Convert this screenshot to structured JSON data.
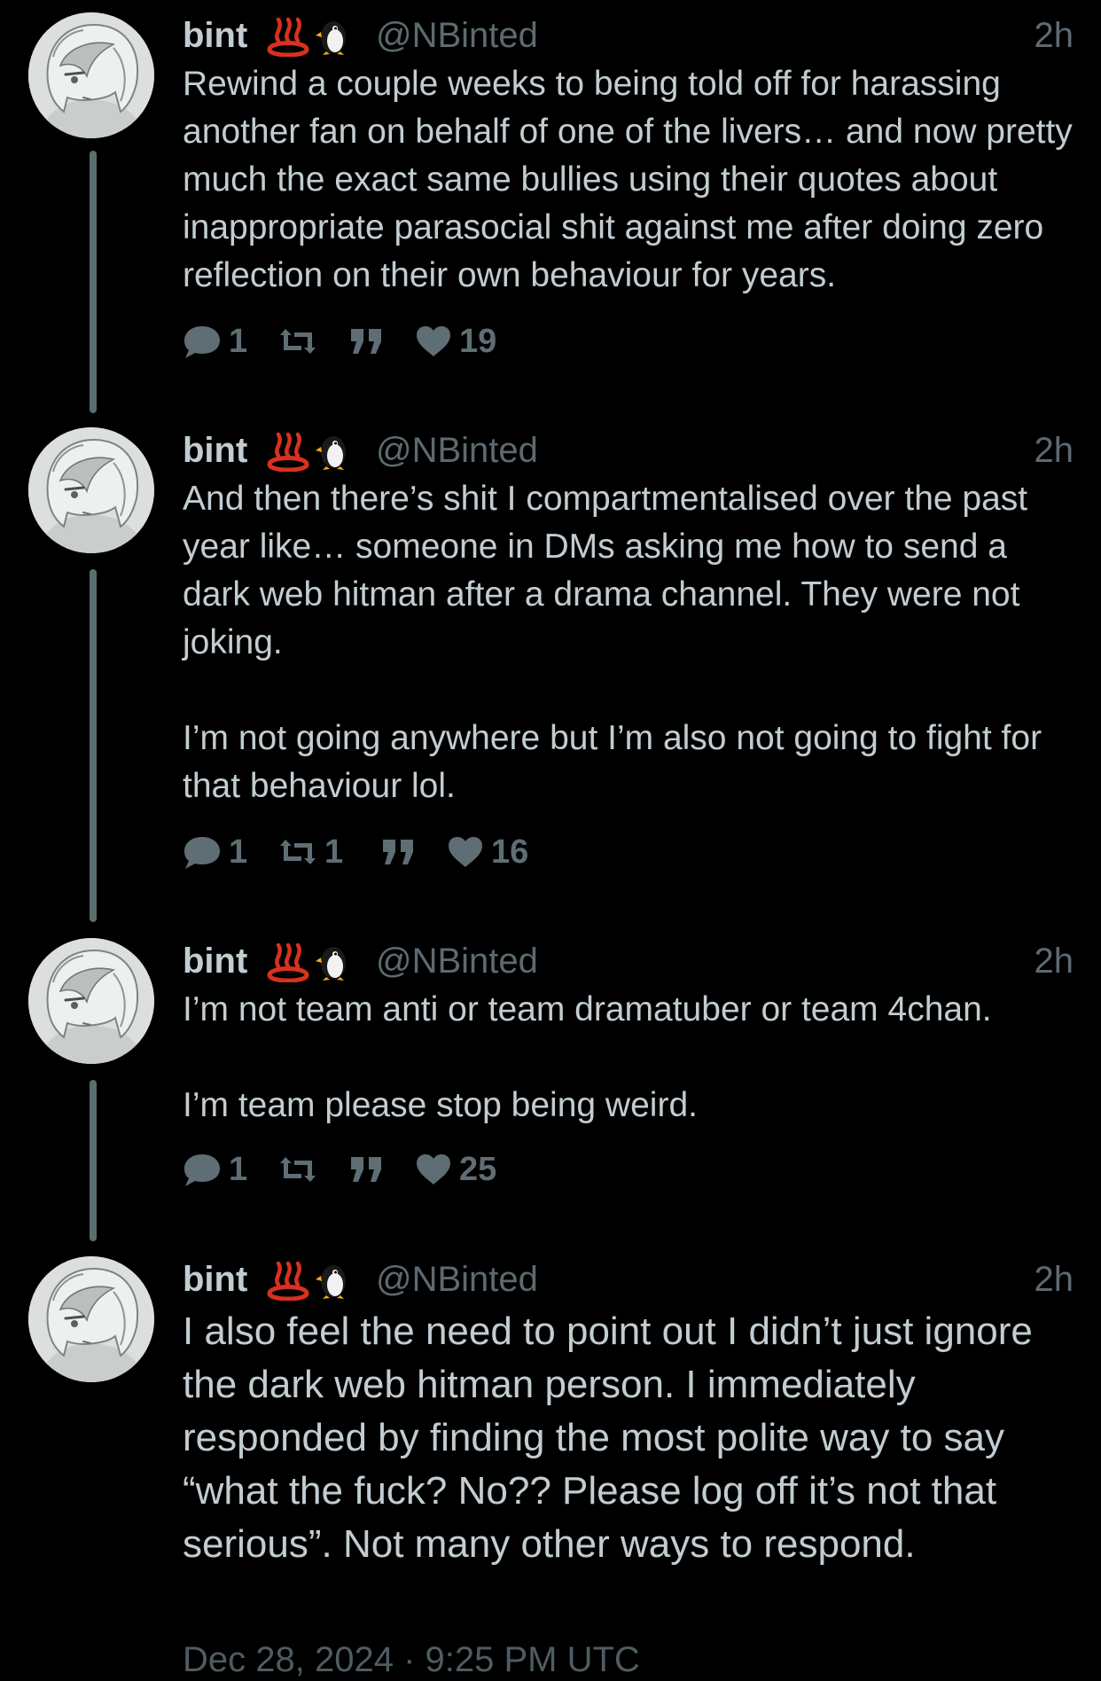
{
  "colors": {
    "background": "#000000",
    "text": "#c2ccd1",
    "muted": "#5d6a70",
    "thread_line": "#5b6e6f"
  },
  "icons": {
    "emoji_1": "hot-springs-emoji",
    "emoji_2": "penguin-emoji",
    "reply": "speech-bubble-icon",
    "retweet": "retweet-icon",
    "quote": "quote-icon",
    "like": "heart-icon"
  },
  "tweets": [
    {
      "name": "bint",
      "handle": "@NBinted",
      "time": "2h",
      "paragraphs": [
        "Rewind a couple weeks to being told off for harassing another fan on behalf of one of the livers… and now pretty much the exact same bullies using their quotes about inappropriate parasocial shit against me after doing zero reflection on their own behaviour for years."
      ],
      "replies": "1",
      "retweets": "",
      "likes": "19"
    },
    {
      "name": "bint",
      "handle": "@NBinted",
      "time": "2h",
      "paragraphs": [
        "And then there’s shit I compartmentalised over the past year like… someone in DMs asking me how to send a dark web hitman after a drama channel. They were not joking.",
        "I’m not going anywhere but I’m also not going to fight for that behaviour lol."
      ],
      "replies": "1",
      "retweets": "1",
      "likes": "16"
    },
    {
      "name": "bint",
      "handle": "@NBinted",
      "time": "2h",
      "paragraphs": [
        "I’m not team anti or team dramatuber or team 4chan.",
        "I’m team please stop being weird."
      ],
      "replies": "1",
      "retweets": "",
      "likes": "25"
    },
    {
      "name": "bint",
      "handle": "@NBinted",
      "time": "2h",
      "paragraphs": [
        "I also feel the need to point out I didn’t just ignore the dark web hitman person. I immediately responded by finding the most polite way to say “what the fuck? No?? Please log off it’s not that serious”. Not many other ways to respond."
      ],
      "date": "Dec 28, 2024 · 9:25 PM UTC"
    }
  ]
}
